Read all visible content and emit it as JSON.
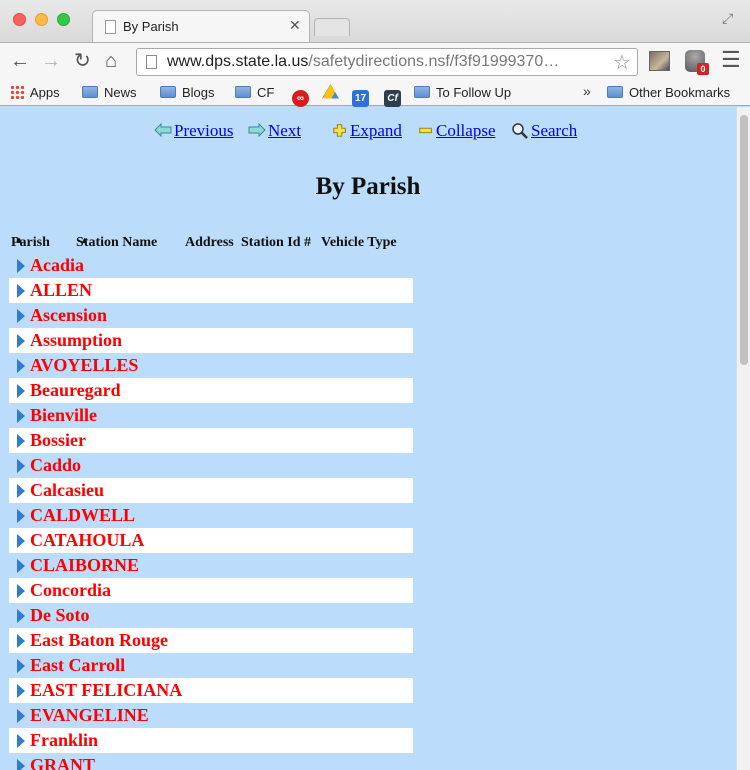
{
  "browser": {
    "tab_title": "By Parish",
    "url_host": "www.dps.state.la.us",
    "url_path": "/safetydirections.nsf/f3f91999370…",
    "extension_badge": "0",
    "bookmarks": [
      {
        "label": "Apps",
        "icon": "apps-grid-icon"
      },
      {
        "label": "News",
        "icon": "folder-icon"
      },
      {
        "label": "Blogs",
        "icon": "folder-icon"
      },
      {
        "label": "CF",
        "icon": "folder-icon"
      },
      {
        "label": "",
        "icon": "adobe-cc-icon"
      },
      {
        "label": "",
        "icon": "google-drive-icon"
      },
      {
        "label": "17",
        "icon": "calendar-icon"
      },
      {
        "label": "Cf",
        "icon": "cf-icon"
      },
      {
        "label": "To Follow Up",
        "icon": "folder-icon"
      }
    ],
    "overflow_chevron": "»",
    "other_bookmarks": "Other Bookmarks"
  },
  "actions": {
    "previous": "Previous",
    "next": "Next",
    "expand": "Expand",
    "collapse": "Collapse",
    "search": "Search"
  },
  "page_title": "By Parish",
  "columns": {
    "parish": "Parish",
    "station_name": "Station Name",
    "address": "Address",
    "station_id": "Station Id #",
    "vehicle_type": "Vehicle Type"
  },
  "parishes": [
    "Acadia",
    "ALLEN",
    "Ascension",
    "Assumption",
    "AVOYELLES",
    "Beauregard",
    "Bienville",
    "Bossier",
    "Caddo",
    "Calcasieu",
    "CALDWELL",
    "CATAHOULA",
    "CLAIBORNE",
    "Concordia",
    "De Soto",
    "East Baton Rouge",
    "East Carroll",
    "EAST FELICIANA",
    "EVANGELINE",
    "Franklin",
    "GRANT"
  ],
  "colors": {
    "page_bg": "#bcdcfc",
    "link": "#0000ee",
    "parish_text": "#ff0000",
    "twisty": "#2e7bcf"
  }
}
